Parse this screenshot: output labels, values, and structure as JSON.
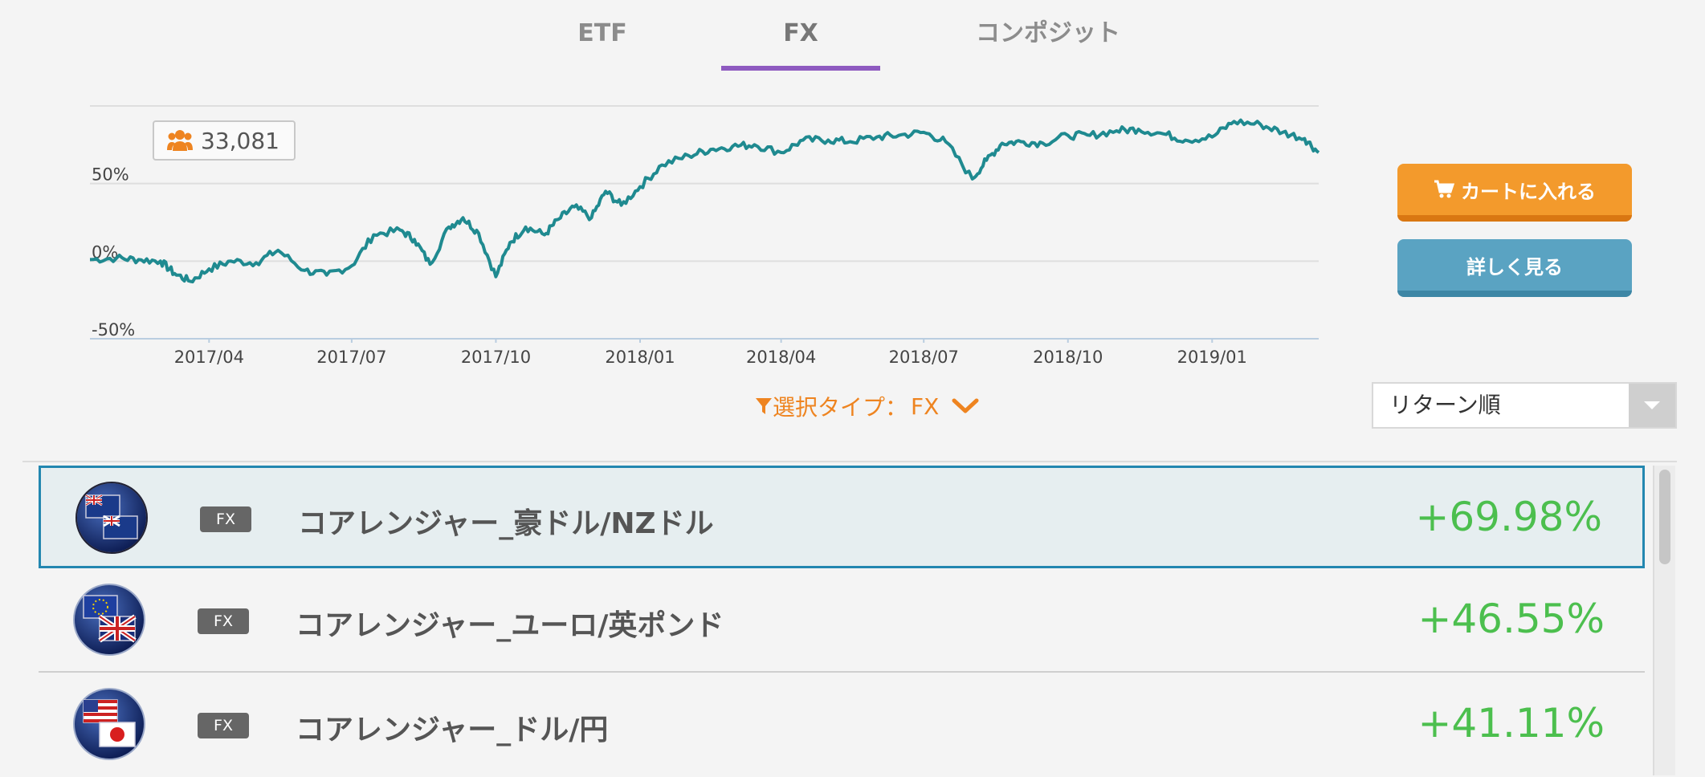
{
  "tabs": [
    {
      "label": "ETF",
      "active": false
    },
    {
      "label": "FX",
      "active": true
    },
    {
      "label": "コンポジット",
      "active": false
    }
  ],
  "active_tab_color": "#8e5ac0",
  "user_count": "33,081",
  "buttons": {
    "cart_label": "カートに入れる",
    "detail_label": "詳しく見る",
    "cart_color": "#f39a2c",
    "detail_color": "#5aa3c2"
  },
  "filter": {
    "label": "選択タイプ：",
    "value": "FX",
    "color": "#ee8420"
  },
  "sort": {
    "selected": "リターン順"
  },
  "chart_data": {
    "type": "line",
    "x_ticks": [
      "2017/04",
      "2017/07",
      "2017/10",
      "2018/01",
      "2018/04",
      "2018/07",
      "2018/10",
      "2019/01"
    ],
    "y_ticks": [
      "50%",
      "0%",
      "-50%"
    ],
    "ylim": [
      -50,
      100
    ],
    "grid": true,
    "series": [
      {
        "color": "#1f8a90",
        "x": [
          "2017/01/15",
          "2017/02/01",
          "2017/02/15",
          "2017/03/01",
          "2017/03/10",
          "2017/03/20",
          "2017/04/01",
          "2017/04/15",
          "2017/05/01",
          "2017/05/15",
          "2017/06/01",
          "2017/06/15",
          "2017/07/01",
          "2017/07/15",
          "2017/08/01",
          "2017/08/10",
          "2017/08/20",
          "2017/09/01",
          "2017/09/10",
          "2017/09/20",
          "2017/10/01",
          "2017/10/10",
          "2017/10/20",
          "2017/11/01",
          "2017/11/10",
          "2017/11/20",
          "2017/12/01",
          "2017/12/10",
          "2017/12/20",
          "2018/01/01",
          "2018/01/15",
          "2018/02/01",
          "2018/02/15",
          "2018/03/01",
          "2018/03/15",
          "2018/04/01",
          "2018/04/15",
          "2018/05/01",
          "2018/05/15",
          "2018/06/01",
          "2018/06/15",
          "2018/07/01",
          "2018/07/15",
          "2018/08/01",
          "2018/08/10",
          "2018/08/20",
          "2018/09/01",
          "2018/09/15",
          "2018/10/01",
          "2018/10/15",
          "2018/11/01",
          "2018/11/15",
          "2018/12/01",
          "2018/12/15",
          "2019/01/01",
          "2019/01/15",
          "2019/02/01",
          "2019/02/15",
          "2019/03/01",
          "2019/03/10"
        ],
        "values": [
          1,
          2,
          1,
          0,
          -8,
          -13,
          -5,
          0,
          -1,
          7,
          -6,
          -9,
          -3,
          17,
          20,
          14,
          -2,
          22,
          28,
          18,
          -10,
          12,
          22,
          17,
          27,
          35,
          28,
          45,
          36,
          48,
          62,
          68,
          72,
          74,
          75,
          70,
          78,
          78,
          77,
          80,
          81,
          83,
          77,
          53,
          65,
          76,
          77,
          76,
          81,
          81,
          84,
          85,
          82,
          78,
          80,
          90,
          88,
          83,
          79,
          70
        ]
      }
    ]
  },
  "items": [
    {
      "type_badge": "FX",
      "name": "コアレンジャー_豪ドル/NZドル",
      "return": "+69.98%",
      "selected": true,
      "flag": "aud-nzd-flag-icon"
    },
    {
      "type_badge": "FX",
      "name": "コアレンジャー_ユーロ/英ポンド",
      "return": "+46.55%",
      "selected": false,
      "flag": "eur-gbp-flag-icon"
    },
    {
      "type_badge": "FX",
      "name": "コアレンジャー_ドル/円",
      "return": "+41.11%",
      "selected": false,
      "flag": "usd-jpy-flag-icon"
    }
  ],
  "return_color": "#4cbf4e"
}
